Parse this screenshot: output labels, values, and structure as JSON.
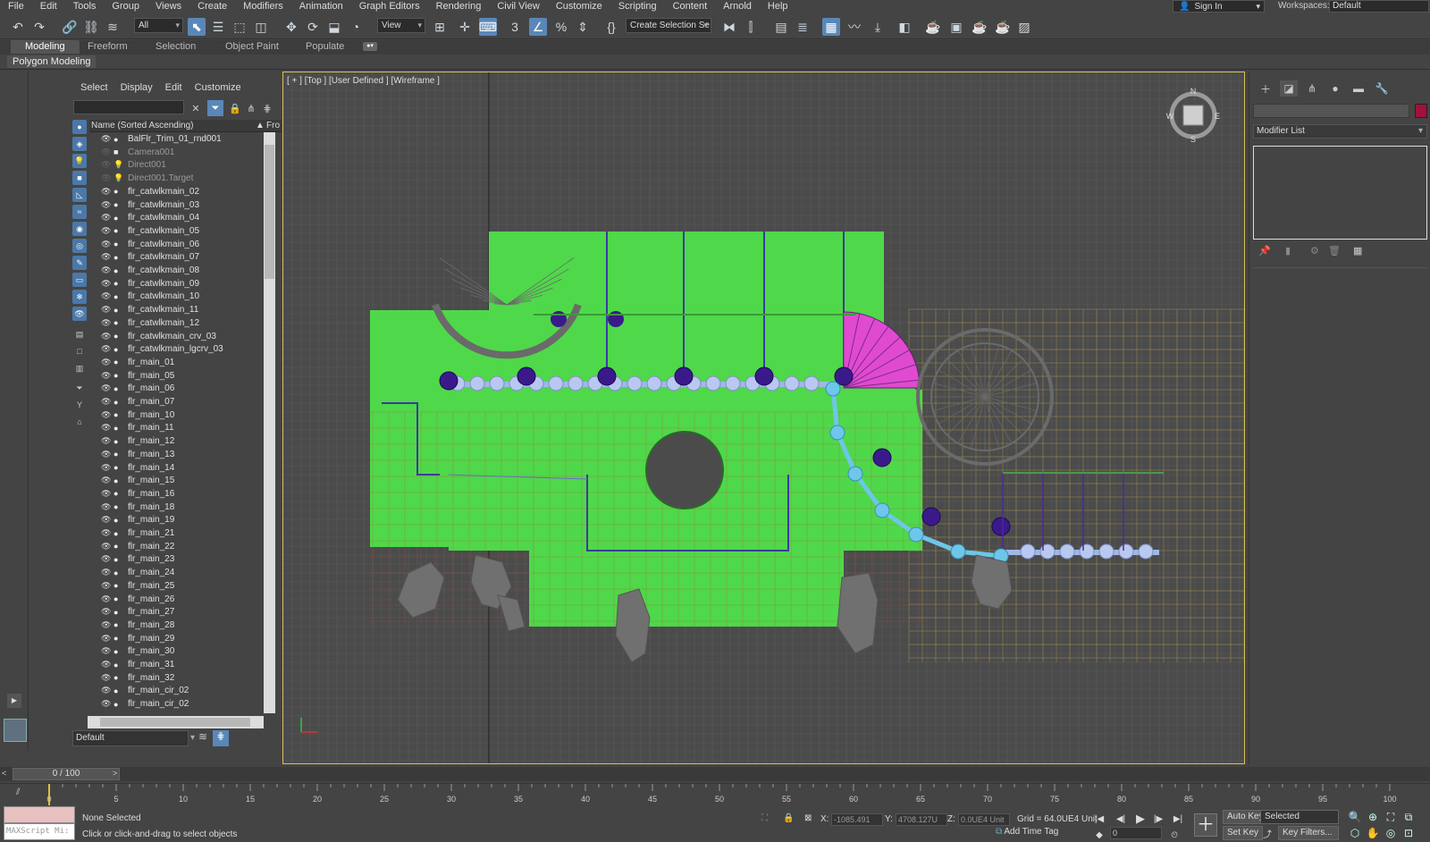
{
  "menu": [
    "File",
    "Edit",
    "Tools",
    "Group",
    "Views",
    "Create",
    "Modifiers",
    "Animation",
    "Graph Editors",
    "Rendering",
    "Civil View",
    "Customize",
    "Scripting",
    "Content",
    "Arnold",
    "Help"
  ],
  "signin": "Sign In",
  "workspaces_label": "Workspaces:",
  "workspace": "Default",
  "toolbar": {
    "selection_filter": "All",
    "ref_coord": "View",
    "selection_set": "Create Selection Se"
  },
  "ribbon": {
    "tabs": [
      "Modeling",
      "Freeform",
      "Selection",
      "Object Paint",
      "Populate"
    ],
    "active_tab": "Modeling",
    "panel": "Polygon Modeling"
  },
  "scene_explorer": {
    "menu": [
      "Select",
      "Display",
      "Edit",
      "Customize"
    ],
    "column_header": "Name (Sorted Ascending)",
    "column_header_sort": "▲",
    "column_header_2": "Fro",
    "rows": [
      {
        "name": "BalFlr_Trim_01_rnd001",
        "type": "geo",
        "hidden": false
      },
      {
        "name": "Camera001",
        "type": "camera",
        "hidden": true
      },
      {
        "name": "Direct001",
        "type": "light",
        "hidden": true
      },
      {
        "name": "Direct001.Target",
        "type": "light",
        "hidden": true
      },
      {
        "name": "flr_catwlkmain_02",
        "type": "geo",
        "hidden": false
      },
      {
        "name": "flr_catwlkmain_03",
        "type": "geo",
        "hidden": false
      },
      {
        "name": "flr_catwlkmain_04",
        "type": "geo",
        "hidden": false
      },
      {
        "name": "flr_catwlkmain_05",
        "type": "geo",
        "hidden": false
      },
      {
        "name": "flr_catwlkmain_06",
        "type": "geo",
        "hidden": false
      },
      {
        "name": "flr_catwlkmain_07",
        "type": "geo",
        "hidden": false
      },
      {
        "name": "flr_catwlkmain_08",
        "type": "geo",
        "hidden": false
      },
      {
        "name": "flr_catwlkmain_09",
        "type": "geo",
        "hidden": false
      },
      {
        "name": "flr_catwlkmain_10",
        "type": "geo",
        "hidden": false
      },
      {
        "name": "flr_catwlkmain_11",
        "type": "geo",
        "hidden": false
      },
      {
        "name": "flr_catwlkmain_12",
        "type": "geo",
        "hidden": false
      },
      {
        "name": "flr_catwlkmain_crv_03",
        "type": "geo",
        "hidden": false
      },
      {
        "name": "flr_catwlkmain_lgcrv_03",
        "type": "geo",
        "hidden": false
      },
      {
        "name": "flr_main_01",
        "type": "geo",
        "hidden": false
      },
      {
        "name": "flr_main_05",
        "type": "geo",
        "hidden": false
      },
      {
        "name": "flr_main_06",
        "type": "geo",
        "hidden": false
      },
      {
        "name": "flr_main_07",
        "type": "geo",
        "hidden": false
      },
      {
        "name": "flr_main_10",
        "type": "geo",
        "hidden": false
      },
      {
        "name": "flr_main_11",
        "type": "geo",
        "hidden": false
      },
      {
        "name": "flr_main_12",
        "type": "geo",
        "hidden": false
      },
      {
        "name": "flr_main_13",
        "type": "geo",
        "hidden": false
      },
      {
        "name": "flr_main_14",
        "type": "geo",
        "hidden": false
      },
      {
        "name": "flr_main_15",
        "type": "geo",
        "hidden": false
      },
      {
        "name": "flr_main_16",
        "type": "geo",
        "hidden": false
      },
      {
        "name": "flr_main_18",
        "type": "geo",
        "hidden": false
      },
      {
        "name": "flr_main_19",
        "type": "geo",
        "hidden": false
      },
      {
        "name": "flr_main_21",
        "type": "geo",
        "hidden": false
      },
      {
        "name": "flr_main_22",
        "type": "geo",
        "hidden": false
      },
      {
        "name": "flr_main_23",
        "type": "geo",
        "hidden": false
      },
      {
        "name": "flr_main_24",
        "type": "geo",
        "hidden": false
      },
      {
        "name": "flr_main_25",
        "type": "geo",
        "hidden": false
      },
      {
        "name": "flr_main_26",
        "type": "geo",
        "hidden": false
      },
      {
        "name": "flr_main_27",
        "type": "geo",
        "hidden": false
      },
      {
        "name": "flr_main_28",
        "type": "geo",
        "hidden": false
      },
      {
        "name": "flr_main_29",
        "type": "geo",
        "hidden": false
      },
      {
        "name": "flr_main_30",
        "type": "geo",
        "hidden": false
      },
      {
        "name": "flr_main_31",
        "type": "geo",
        "hidden": false
      },
      {
        "name": "flr_main_32",
        "type": "geo",
        "hidden": false
      },
      {
        "name": "flr_main_cir_02",
        "type": "geo",
        "hidden": false
      },
      {
        "name": "flr_main_cir_02",
        "type": "geo",
        "hidden": false
      }
    ],
    "layer": "Default"
  },
  "viewport": {
    "label": "[ + ] [Top ] [User Defined ] [Wireframe ]",
    "viewcube": {
      "n": "N",
      "s": "S",
      "e": "E",
      "w": "W"
    }
  },
  "command_panel": {
    "modifier_list": "Modifier List",
    "object_color": "#a0123c"
  },
  "timeline": {
    "frame_display": "0 / 100",
    "start": 0,
    "end": 100,
    "current": 0,
    "labels": [
      "0",
      "5",
      "10",
      "15",
      "20",
      "25",
      "30",
      "35",
      "40",
      "45",
      "50",
      "55",
      "60",
      "65",
      "70",
      "75",
      "80",
      "85",
      "90",
      "95",
      "100"
    ]
  },
  "status": {
    "maxscript": "MAXScript Mi:",
    "selection": "None Selected",
    "prompt": "Click or click-and-drag to select objects",
    "x_label": "X:",
    "x": "-1085.491",
    "y_label": "Y:",
    "y": "4708.127U",
    "z_label": "Z:",
    "z": "0.0UE4 Unit",
    "grid": "Grid = 64.0UE4 Unit",
    "add_time_tag": "Add Time Tag",
    "auto_key": "Auto Key",
    "set_key": "Set Key",
    "key_mode": "Selected",
    "key_filters": "Key Filters...",
    "frame": "0"
  },
  "colors": {
    "floor": "#4fd84a",
    "stairs": "#e04ad0",
    "spline": "#6ec6e8",
    "grid_major": "#d4b84a",
    "accent": "#5a87b8"
  }
}
